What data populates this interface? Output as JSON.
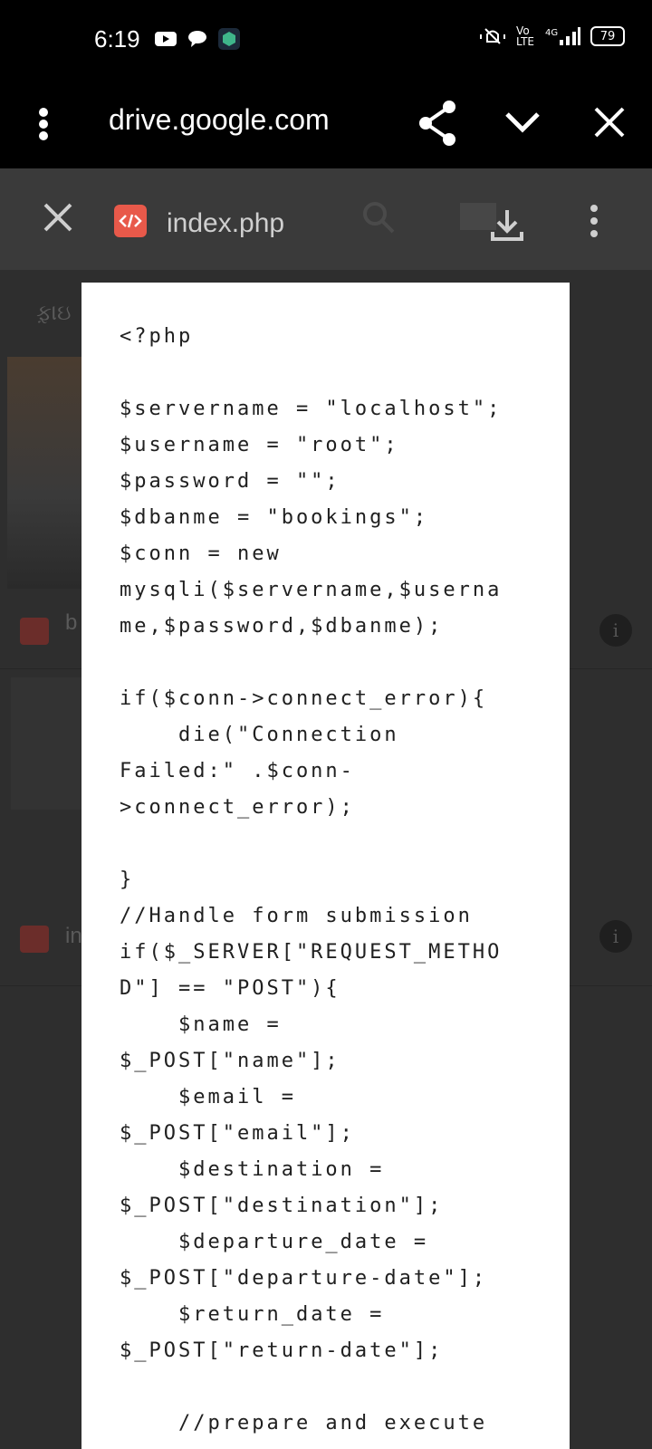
{
  "status_bar": {
    "time": "6:19",
    "battery": "79"
  },
  "browser": {
    "url": "drive.google.com"
  },
  "drive_toolbar": {
    "file_name": "index.php"
  },
  "background": {
    "row_fragments": [
      "ફ઼ાઇ",
      "b",
      "in"
    ]
  },
  "code_lines": [
    "<?php",
    "",
    "$servername = \"localhost\";",
    "$username = \"root\";",
    "$password = \"\";",
    "$dbanme = \"bookings\";",
    "$conn = new",
    "mysqli($servername,$userna",
    "me,$password,$dbanme);",
    "",
    "if($conn->connect_error){",
    "    die(\"Connection",
    "Failed:\" .$conn-",
    ">connect_error);",
    "",
    "}",
    "//Handle form submission",
    "if($_SERVER[\"REQUEST_METHO",
    "D\"] == \"POST\"){",
    "    $name =",
    "$_POST[\"name\"];",
    "    $email =",
    "$_POST[\"email\"];",
    "    $destination =",
    "$_POST[\"destination\"];",
    "    $departure_date =",
    "$_POST[\"departure-date\"];",
    "    $return_date =",
    "$_POST[\"return-date\"];",
    "",
    "    //prepare and execute"
  ]
}
